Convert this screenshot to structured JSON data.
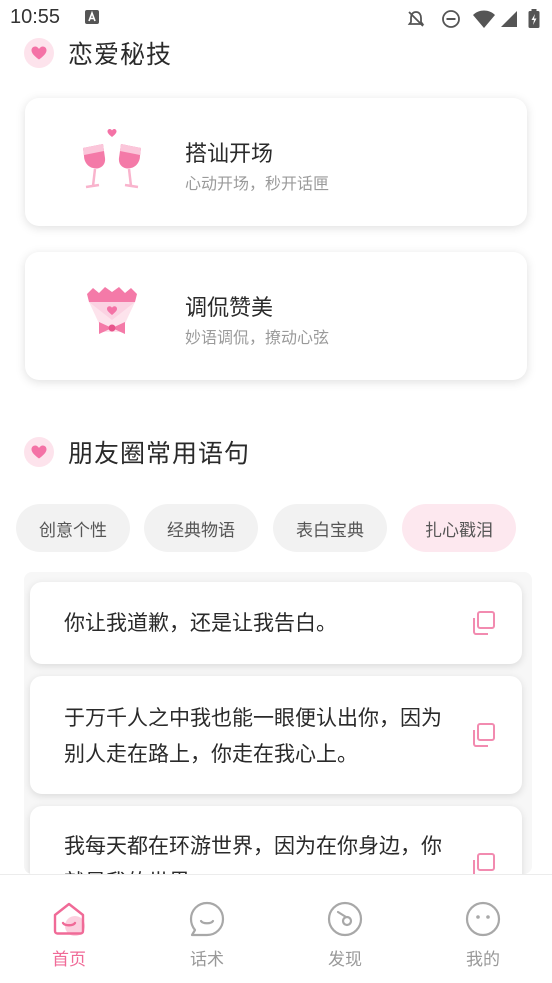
{
  "status_bar": {
    "time": "10:55"
  },
  "section_tips": {
    "title": "恋爱秘技",
    "cards": [
      {
        "title": "搭讪开场",
        "subtitle": "心动开场，秒开话匣",
        "icon": "wine-glasses-icon"
      },
      {
        "title": "调侃赞美",
        "subtitle": "妙语调侃，撩动心弦",
        "icon": "bouquet-icon"
      }
    ]
  },
  "section_moments": {
    "title": "朋友圈常用语句",
    "chips": [
      {
        "label": "创意个性",
        "active": false
      },
      {
        "label": "经典物语",
        "active": false
      },
      {
        "label": "表白宝典",
        "active": false
      },
      {
        "label": "扎心戳泪",
        "active": true
      }
    ],
    "phrases": [
      "你让我道歉，还是让我告白。",
      "于万千人之中我也能一眼便认出你，因为别人走在路上，你走在我心上。",
      "我每天都在环游世界，因为在你身边，你就是我的世界。"
    ]
  },
  "bottom_nav": {
    "items": [
      {
        "label": "首页",
        "icon": "home-icon",
        "active": true
      },
      {
        "label": "话术",
        "icon": "chat-bubble-icon",
        "active": false
      },
      {
        "label": "发现",
        "icon": "compass-icon",
        "active": false
      },
      {
        "label": "我的",
        "icon": "profile-face-icon",
        "active": false
      }
    ]
  },
  "colors": {
    "accent": "#f06a97",
    "heart": "#f472a6",
    "chip_active_bg": "#fde8ef"
  }
}
